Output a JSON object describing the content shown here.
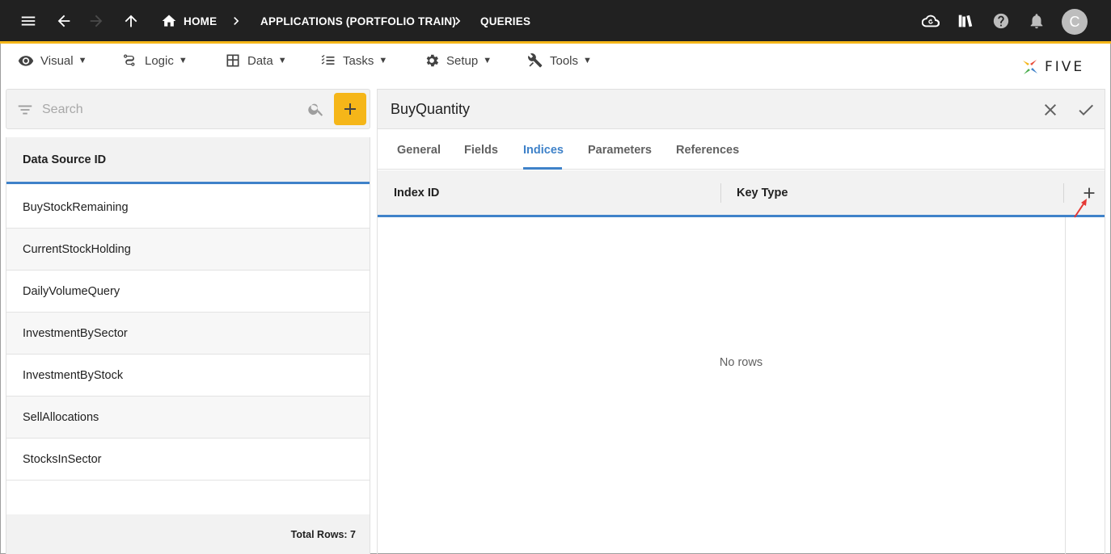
{
  "topbar": {
    "breadcrumbs": [
      "HOME",
      "APPLICATIONS (PORTFOLIO TRAIN)",
      "QUERIES"
    ],
    "avatar_initial": "C",
    "icons": [
      "menu-icon",
      "back-arrow-icon",
      "forward-arrow-icon",
      "up-arrow-icon",
      "home-icon",
      "cloud-sync-icon",
      "library-icon",
      "help-icon",
      "bell-icon"
    ]
  },
  "menu": {
    "items": [
      {
        "label": "Visual",
        "icon": "eye-icon"
      },
      {
        "label": "Logic",
        "icon": "flow-icon"
      },
      {
        "label": "Data",
        "icon": "table-icon"
      },
      {
        "label": "Tasks",
        "icon": "checklist-icon"
      },
      {
        "label": "Setup",
        "icon": "gear-icon"
      },
      {
        "label": "Tools",
        "icon": "tools-icon"
      }
    ],
    "caret": "▼",
    "logo_text": "FIVE"
  },
  "left": {
    "search_placeholder": "Search",
    "column_header": "Data Source ID",
    "rows": [
      "BuyStockRemaining",
      "CurrentStockHolding",
      "DailyVolumeQuery",
      "InvestmentBySector",
      "InvestmentByStock",
      "SellAllocations",
      "StocksInSector"
    ],
    "footer": "Total Rows: 7"
  },
  "right": {
    "title": "BuyQuantity",
    "tabs": [
      "General",
      "Fields",
      "Indices",
      "Parameters",
      "References"
    ],
    "active_tab": "Indices",
    "columns": [
      "Index ID",
      "Key Type"
    ],
    "empty_text": "No rows"
  },
  "colors": {
    "topbar_bg": "#212121",
    "accent_yellow": "#f5b619",
    "accent_blue": "#3f82c9"
  }
}
